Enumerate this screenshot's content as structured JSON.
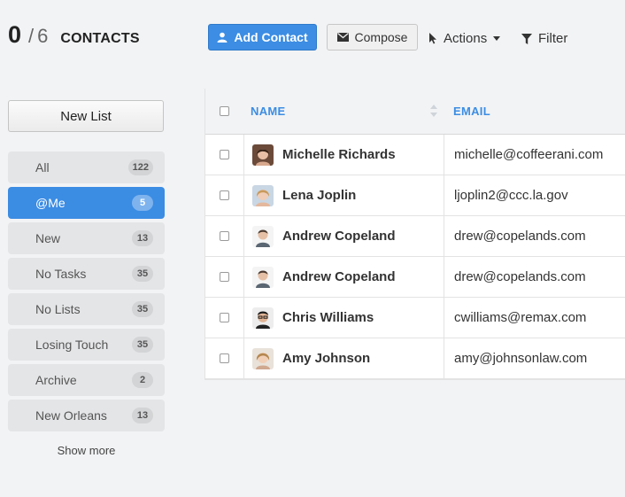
{
  "header": {
    "selected": "0",
    "separator": "/",
    "total": "6",
    "label": "CONTACTS"
  },
  "toolbar": {
    "add_label": "Add Contact",
    "compose_label": "Compose",
    "actions_label": "Actions",
    "filter_label": "Filter"
  },
  "sidebar": {
    "new_list_label": "New List",
    "items": [
      {
        "label": "All",
        "count": "122"
      },
      {
        "label": "@Me",
        "count": "5"
      },
      {
        "label": "New",
        "count": "13"
      },
      {
        "label": "No Tasks",
        "count": "35"
      },
      {
        "label": "No Lists",
        "count": "35"
      },
      {
        "label": "Losing Touch",
        "count": "35"
      },
      {
        "label": "Archive",
        "count": "2"
      },
      {
        "label": "New Orleans",
        "count": "13"
      }
    ],
    "show_more": "Show more"
  },
  "table": {
    "columns": [
      "NAME",
      "EMAIL"
    ],
    "rows": [
      {
        "name": "Michelle Richards",
        "email": "michelle@coffeerani.com"
      },
      {
        "name": "Lena Joplin",
        "email": "ljoplin2@ccc.la.gov"
      },
      {
        "name": "Andrew Copeland",
        "email": "drew@copelands.com"
      },
      {
        "name": "Andrew Copeland",
        "email": "drew@copelands.com"
      },
      {
        "name": "Chris Williams",
        "email": "cwilliams@remax.com"
      },
      {
        "name": "Amy Johnson",
        "email": "amy@johnsonlaw.com"
      }
    ]
  },
  "colors": {
    "accent": "#3c8de3",
    "background": "#f2f3f5"
  }
}
